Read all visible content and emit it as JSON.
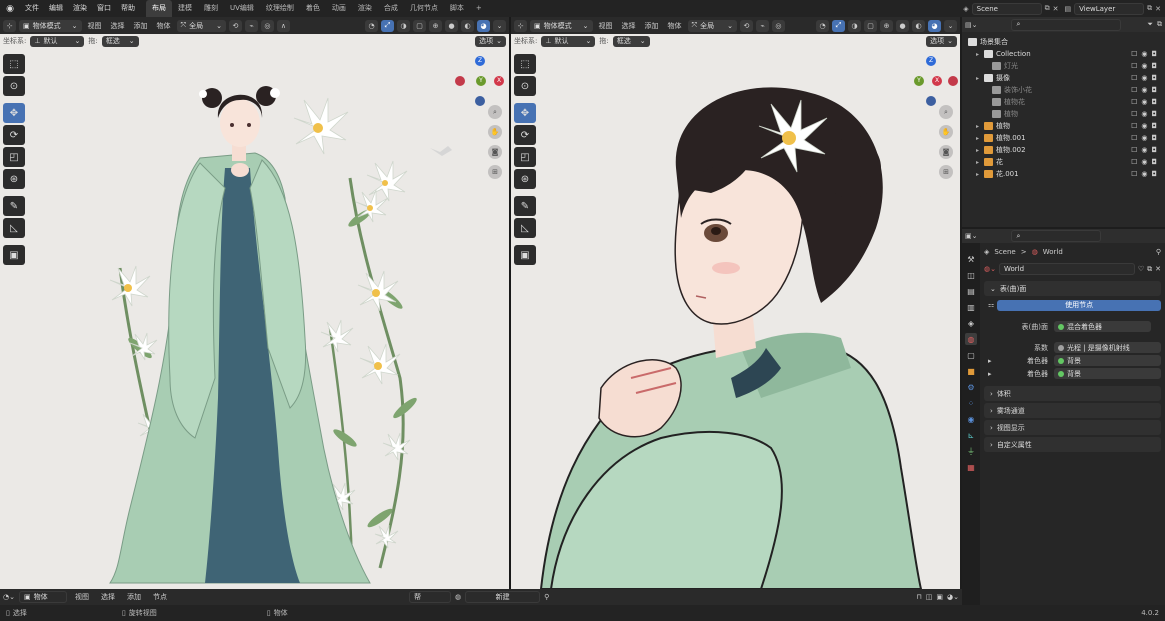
{
  "topbar": {
    "menus": [
      "文件",
      "编辑",
      "渲染",
      "窗口",
      "帮助"
    ],
    "tabs": [
      {
        "label": "布局",
        "active": true
      },
      {
        "label": "建模",
        "active": false
      },
      {
        "label": "雕刻",
        "active": false
      },
      {
        "label": "UV编辑",
        "active": false
      },
      {
        "label": "纹理绘制",
        "active": false
      },
      {
        "label": "着色",
        "active": false
      },
      {
        "label": "动画",
        "active": false
      },
      {
        "label": "渲染",
        "active": false
      },
      {
        "label": "合成",
        "active": false
      },
      {
        "label": "几何节点",
        "active": false
      },
      {
        "label": "脚本",
        "active": false
      }
    ],
    "add_tab": "+",
    "scene": "Scene",
    "view_layer": "ViewLayer"
  },
  "viewport_left": {
    "mode": "物体模式",
    "menus": [
      "视图",
      "选择",
      "添加",
      "物体"
    ],
    "transform": "全局",
    "orientation_label": "坐标系:",
    "orientation_value": "默认",
    "drag_label": "拖:",
    "drag_value": "框选",
    "options": "选项"
  },
  "viewport_right": {
    "mode": "物体模式",
    "menus": [
      "视图",
      "选择",
      "添加",
      "物体"
    ],
    "transform": "全局",
    "orientation_label": "坐标系:",
    "orientation_value": "默认",
    "drag_label": "拖:",
    "drag_value": "框选",
    "options": "选项"
  },
  "gizmo": {
    "z": "Z",
    "y": "Y",
    "x": "X"
  },
  "outliner": {
    "header": "场景集合",
    "rows": [
      {
        "label": "Collection",
        "indent": 1,
        "dim": false,
        "icon_color": "#dcdcdc"
      },
      {
        "label": "灯光",
        "indent": 2,
        "dim": true,
        "icon_color": "#999999"
      },
      {
        "label": "摄像",
        "indent": 1,
        "dim": false,
        "icon_color": "#dcdcdc"
      },
      {
        "label": "装饰小花",
        "indent": 2,
        "dim": true,
        "icon_color": "#999999"
      },
      {
        "label": "植物花",
        "indent": 2,
        "dim": true,
        "icon_color": "#999999"
      },
      {
        "label": "植物",
        "indent": 2,
        "dim": true,
        "icon_color": "#999999"
      },
      {
        "label": "植物",
        "indent": 1,
        "dim": false,
        "icon_color": "#e09a3a"
      },
      {
        "label": "植物.001",
        "indent": 1,
        "dim": false,
        "icon_color": "#e09a3a"
      },
      {
        "label": "植物.002",
        "indent": 1,
        "dim": false,
        "icon_color": "#e09a3a"
      },
      {
        "label": "花",
        "indent": 1,
        "dim": false,
        "icon_color": "#e09a3a"
      },
      {
        "label": "花.001",
        "indent": 1,
        "dim": false,
        "icon_color": "#e09a3a"
      }
    ]
  },
  "properties": {
    "breadcrumb_scene": "Scene",
    "breadcrumb_sep": ">",
    "breadcrumb_world": "World",
    "world_name": "World",
    "surface_panel": "表(曲)面",
    "use_nodes": "使用节点",
    "surface_label": "表(曲)面",
    "surface_value": "混合着色器",
    "factor_label": "系数",
    "factor_value": "光程 | 是摄像机射线",
    "shader1_label": "着色器",
    "shader1_value": "背景",
    "shader2_label": "着色器",
    "shader2_value": "背景",
    "volume_panel": "体积",
    "mist_panel": "雾场通道",
    "viewport_display_panel": "视图显示",
    "custom_props_panel": "自定义属性"
  },
  "timeline": {
    "mode": "物体",
    "menus": [
      "视图",
      "选择",
      "添加",
      "节点"
    ],
    "slot_placeholder": "帮",
    "new_button": "新建"
  },
  "statusbar": {
    "select": "选择",
    "rotate_view": "旋转视图",
    "object": "物体",
    "version": "4.0.2"
  },
  "colors": {
    "accent": "#4772b3",
    "gizmo_z": "#2f6bd8",
    "gizmo_y": "#6a9a2c",
    "gizmo_x": "#d2384a",
    "viewport_bg": "#ebe9e6",
    "robe": "#a8cdb3",
    "under_robe": "#3f6475"
  }
}
